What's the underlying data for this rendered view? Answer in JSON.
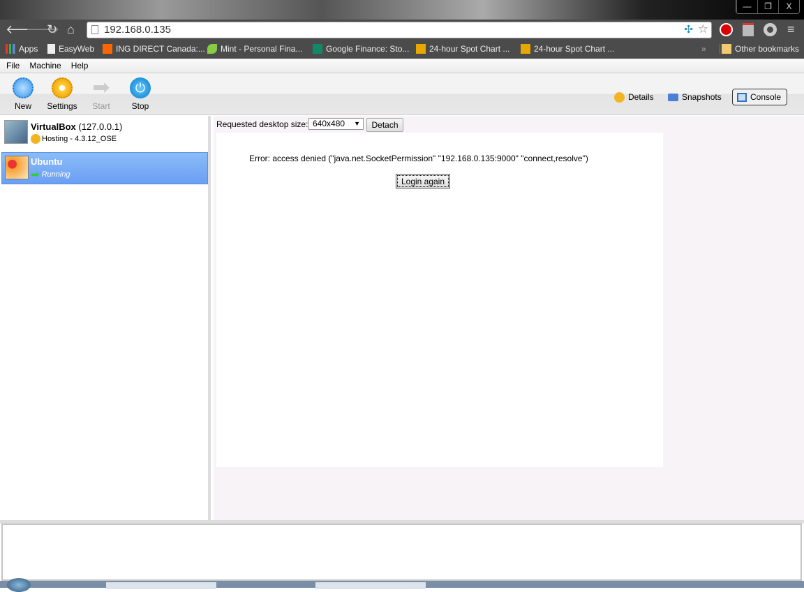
{
  "browser": {
    "url": "192.168.0.135",
    "window_controls": [
      "—",
      "❐",
      "X"
    ],
    "bookmarks": [
      {
        "label": "Apps",
        "icon": "apps-grid-icon"
      },
      {
        "label": "EasyWeb",
        "icon": "page-icon"
      },
      {
        "label": "ING DIRECT Canada:...",
        "icon": "ing-icon"
      },
      {
        "label": "Mint - Personal Fina...",
        "icon": "leaf-icon"
      },
      {
        "label": "Google Finance: Sto...",
        "icon": "google-finance-icon"
      },
      {
        "label": "24-hour Spot Chart ...",
        "icon": "kitco-icon"
      },
      {
        "label": "24-hour Spot Chart ...",
        "icon": "kitco-icon"
      }
    ],
    "overflow": "»",
    "other_bookmarks": "Other bookmarks"
  },
  "menu": [
    "File",
    "Machine",
    "Help"
  ],
  "toolbar": {
    "new": "New",
    "settings": "Settings",
    "start": "Start",
    "stop": "Stop",
    "details": "Details",
    "snapshots": "Snapshots",
    "console": "Console"
  },
  "vms": [
    {
      "name": "VirtualBox",
      "host": "(127.0.0.1)",
      "status": "Hosting - 4.3.12_OSE"
    },
    {
      "name": "Ubuntu",
      "status": "Running"
    }
  ],
  "console": {
    "size_label": "Requested desktop size:",
    "size_value": "640x480",
    "detach": "Detach",
    "error": "Error: access denied (\"java.net.SocketPermission\" \"192.168.0.135:9000\" \"connect,resolve\")",
    "login_again": "Login again"
  }
}
